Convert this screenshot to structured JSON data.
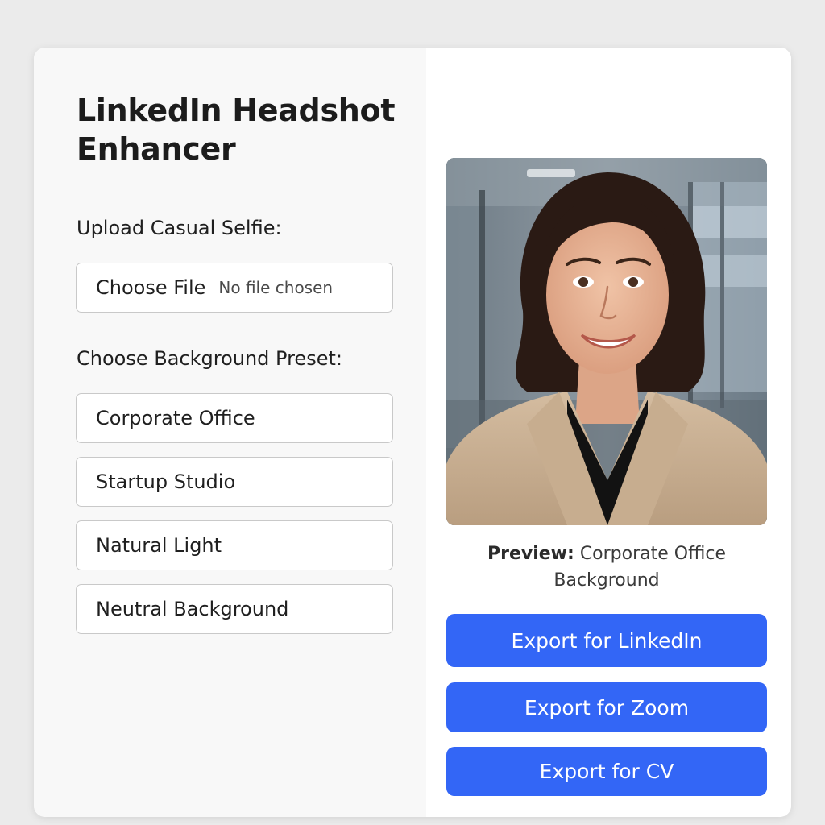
{
  "app": {
    "title": "LinkedIn Headshot Enhancer"
  },
  "upload": {
    "label": "Upload Casual Selfie:",
    "button_label": "Choose File",
    "status_text": "No file chosen"
  },
  "presets": {
    "label": "Choose Background Preset:",
    "options": [
      "Corporate Office",
      "Startup Studio",
      "Natural Light",
      "Neutral Background"
    ]
  },
  "preview": {
    "image_icon": "headshot-photo",
    "caption_label": "Preview:",
    "caption_value": "Corporate Office Background"
  },
  "export": {
    "buttons": [
      "Export for LinkedIn",
      "Export for Zoom",
      "Export for CV"
    ]
  },
  "colors": {
    "accent": "#3366f6",
    "page_background": "#ebebeb",
    "left_panel": "#f8f8f8",
    "card": "#ffffff"
  }
}
